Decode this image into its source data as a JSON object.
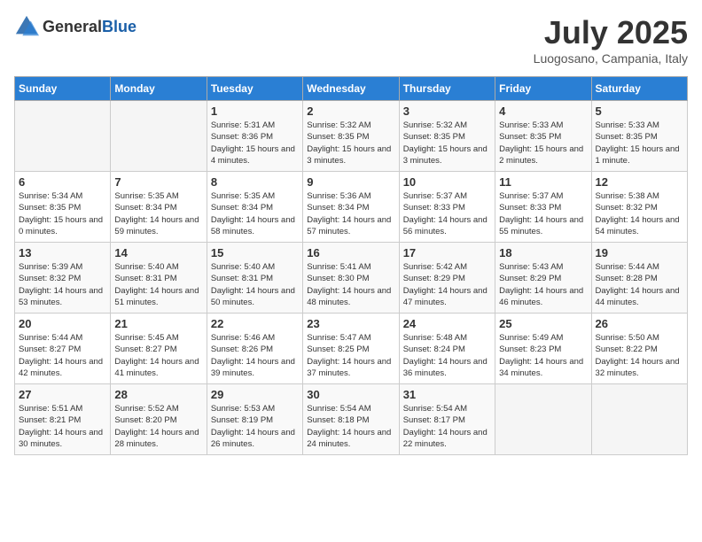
{
  "header": {
    "logo_general": "General",
    "logo_blue": "Blue",
    "month_year": "July 2025",
    "location": "Luogosano, Campania, Italy"
  },
  "days_of_week": [
    "Sunday",
    "Monday",
    "Tuesday",
    "Wednesday",
    "Thursday",
    "Friday",
    "Saturday"
  ],
  "weeks": [
    [
      {
        "day": "",
        "info": ""
      },
      {
        "day": "",
        "info": ""
      },
      {
        "day": "1",
        "info": "Sunrise: 5:31 AM\nSunset: 8:36 PM\nDaylight: 15 hours and 4 minutes."
      },
      {
        "day": "2",
        "info": "Sunrise: 5:32 AM\nSunset: 8:35 PM\nDaylight: 15 hours and 3 minutes."
      },
      {
        "day": "3",
        "info": "Sunrise: 5:32 AM\nSunset: 8:35 PM\nDaylight: 15 hours and 3 minutes."
      },
      {
        "day": "4",
        "info": "Sunrise: 5:33 AM\nSunset: 8:35 PM\nDaylight: 15 hours and 2 minutes."
      },
      {
        "day": "5",
        "info": "Sunrise: 5:33 AM\nSunset: 8:35 PM\nDaylight: 15 hours and 1 minute."
      }
    ],
    [
      {
        "day": "6",
        "info": "Sunrise: 5:34 AM\nSunset: 8:35 PM\nDaylight: 15 hours and 0 minutes."
      },
      {
        "day": "7",
        "info": "Sunrise: 5:35 AM\nSunset: 8:34 PM\nDaylight: 14 hours and 59 minutes."
      },
      {
        "day": "8",
        "info": "Sunrise: 5:35 AM\nSunset: 8:34 PM\nDaylight: 14 hours and 58 minutes."
      },
      {
        "day": "9",
        "info": "Sunrise: 5:36 AM\nSunset: 8:34 PM\nDaylight: 14 hours and 57 minutes."
      },
      {
        "day": "10",
        "info": "Sunrise: 5:37 AM\nSunset: 8:33 PM\nDaylight: 14 hours and 56 minutes."
      },
      {
        "day": "11",
        "info": "Sunrise: 5:37 AM\nSunset: 8:33 PM\nDaylight: 14 hours and 55 minutes."
      },
      {
        "day": "12",
        "info": "Sunrise: 5:38 AM\nSunset: 8:32 PM\nDaylight: 14 hours and 54 minutes."
      }
    ],
    [
      {
        "day": "13",
        "info": "Sunrise: 5:39 AM\nSunset: 8:32 PM\nDaylight: 14 hours and 53 minutes."
      },
      {
        "day": "14",
        "info": "Sunrise: 5:40 AM\nSunset: 8:31 PM\nDaylight: 14 hours and 51 minutes."
      },
      {
        "day": "15",
        "info": "Sunrise: 5:40 AM\nSunset: 8:31 PM\nDaylight: 14 hours and 50 minutes."
      },
      {
        "day": "16",
        "info": "Sunrise: 5:41 AM\nSunset: 8:30 PM\nDaylight: 14 hours and 48 minutes."
      },
      {
        "day": "17",
        "info": "Sunrise: 5:42 AM\nSunset: 8:29 PM\nDaylight: 14 hours and 47 minutes."
      },
      {
        "day": "18",
        "info": "Sunrise: 5:43 AM\nSunset: 8:29 PM\nDaylight: 14 hours and 46 minutes."
      },
      {
        "day": "19",
        "info": "Sunrise: 5:44 AM\nSunset: 8:28 PM\nDaylight: 14 hours and 44 minutes."
      }
    ],
    [
      {
        "day": "20",
        "info": "Sunrise: 5:44 AM\nSunset: 8:27 PM\nDaylight: 14 hours and 42 minutes."
      },
      {
        "day": "21",
        "info": "Sunrise: 5:45 AM\nSunset: 8:27 PM\nDaylight: 14 hours and 41 minutes."
      },
      {
        "day": "22",
        "info": "Sunrise: 5:46 AM\nSunset: 8:26 PM\nDaylight: 14 hours and 39 minutes."
      },
      {
        "day": "23",
        "info": "Sunrise: 5:47 AM\nSunset: 8:25 PM\nDaylight: 14 hours and 37 minutes."
      },
      {
        "day": "24",
        "info": "Sunrise: 5:48 AM\nSunset: 8:24 PM\nDaylight: 14 hours and 36 minutes."
      },
      {
        "day": "25",
        "info": "Sunrise: 5:49 AM\nSunset: 8:23 PM\nDaylight: 14 hours and 34 minutes."
      },
      {
        "day": "26",
        "info": "Sunrise: 5:50 AM\nSunset: 8:22 PM\nDaylight: 14 hours and 32 minutes."
      }
    ],
    [
      {
        "day": "27",
        "info": "Sunrise: 5:51 AM\nSunset: 8:21 PM\nDaylight: 14 hours and 30 minutes."
      },
      {
        "day": "28",
        "info": "Sunrise: 5:52 AM\nSunset: 8:20 PM\nDaylight: 14 hours and 28 minutes."
      },
      {
        "day": "29",
        "info": "Sunrise: 5:53 AM\nSunset: 8:19 PM\nDaylight: 14 hours and 26 minutes."
      },
      {
        "day": "30",
        "info": "Sunrise: 5:54 AM\nSunset: 8:18 PM\nDaylight: 14 hours and 24 minutes."
      },
      {
        "day": "31",
        "info": "Sunrise: 5:54 AM\nSunset: 8:17 PM\nDaylight: 14 hours and 22 minutes."
      },
      {
        "day": "",
        "info": ""
      },
      {
        "day": "",
        "info": ""
      }
    ]
  ]
}
